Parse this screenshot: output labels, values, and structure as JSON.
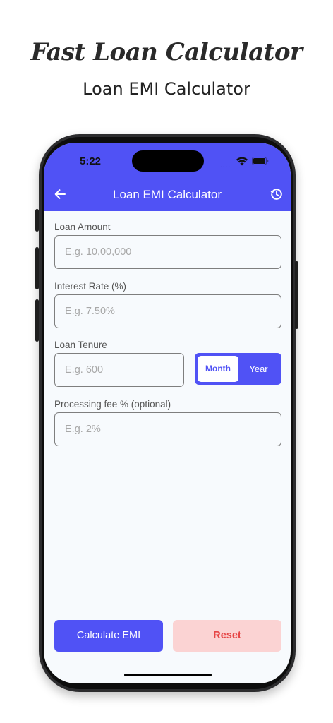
{
  "promo": {
    "title": "Fast Loan Calculator",
    "subtitle": "Loan EMI Calculator"
  },
  "status_bar": {
    "time": "5:22",
    "dots": "...."
  },
  "app_bar": {
    "title": "Loan EMI Calculator",
    "back_icon": "arrow-left-icon",
    "history_icon": "history-icon"
  },
  "form": {
    "loan_amount": {
      "label": "Loan Amount",
      "value": "",
      "placeholder": "E.g. 10,00,000"
    },
    "interest_rate": {
      "label": "Interest Rate (%)",
      "value": "",
      "placeholder": "E.g. 7.50%"
    },
    "loan_tenure": {
      "label": "Loan Tenure",
      "value": "",
      "placeholder": "E.g. 600",
      "unit_options": [
        "Month",
        "Year"
      ],
      "selected_unit": "Month"
    },
    "processing_fee": {
      "label": "Processing fee % (optional)",
      "value": "",
      "placeholder": "E.g. 2%"
    }
  },
  "actions": {
    "calculate_label": "Calculate EMI",
    "reset_label": "Reset"
  },
  "colors": {
    "primary": "#5052f5",
    "reset_bg": "#fbd3d3",
    "reset_text": "#e64646",
    "screen_bg": "#f7fafd"
  }
}
